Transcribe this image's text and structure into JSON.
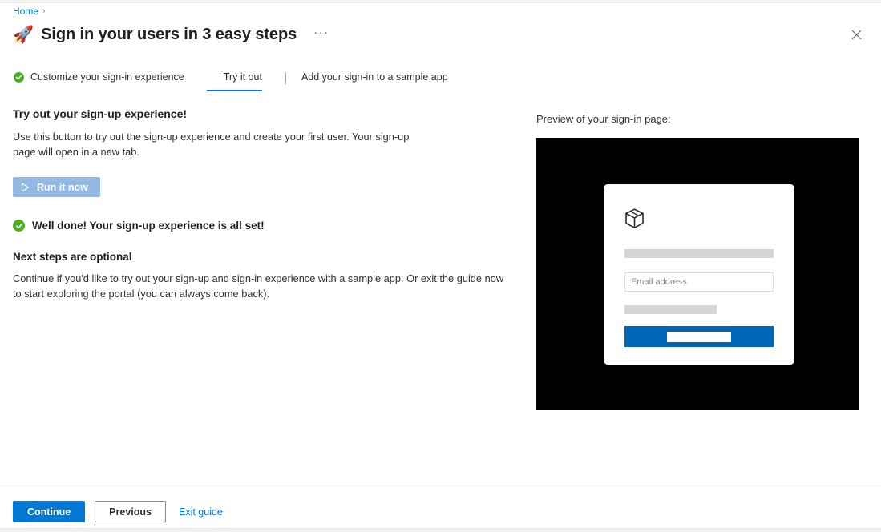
{
  "breadcrumb": {
    "items": [
      "Home"
    ],
    "separator": "›"
  },
  "header": {
    "icon": "rocket-icon",
    "title": "Sign in your users in 3 easy steps",
    "more_label": "···",
    "close_label": "✕"
  },
  "steps": [
    {
      "label": "Customize your sign-in experience",
      "state": "done"
    },
    {
      "label": "Try it out",
      "state": "current"
    },
    {
      "label": "Add your sign-in to a sample app",
      "state": "todo"
    }
  ],
  "main": {
    "heading": "Try out your sign-up experience!",
    "description": "Use this button to try out the sign-up experience and create your first user. Your sign-up page will open in a new tab.",
    "run_button_label": "Run it now",
    "run_button_icon": "play-icon",
    "success_message": "Well done! Your sign-up experience is all set!",
    "next_heading": "Next steps are optional",
    "next_body": "Continue if you'd like to try out your sign-up and sign-in experience with a sample app. Or exit the guide now to start exploring the portal (you can always come back)."
  },
  "preview": {
    "label": "Preview of your sign-in page:",
    "logo_icon": "cube-icon",
    "email_placeholder": "Email address",
    "background_color": "#000000",
    "button_color": "#0067b8"
  },
  "footer": {
    "continue_label": "Continue",
    "previous_label": "Previous",
    "exit_label": "Exit guide"
  },
  "colors": {
    "accent": "#0078d4",
    "success": "#4caf22",
    "disabled_button": "#92b8e3",
    "preview_button": "#0067b8"
  }
}
